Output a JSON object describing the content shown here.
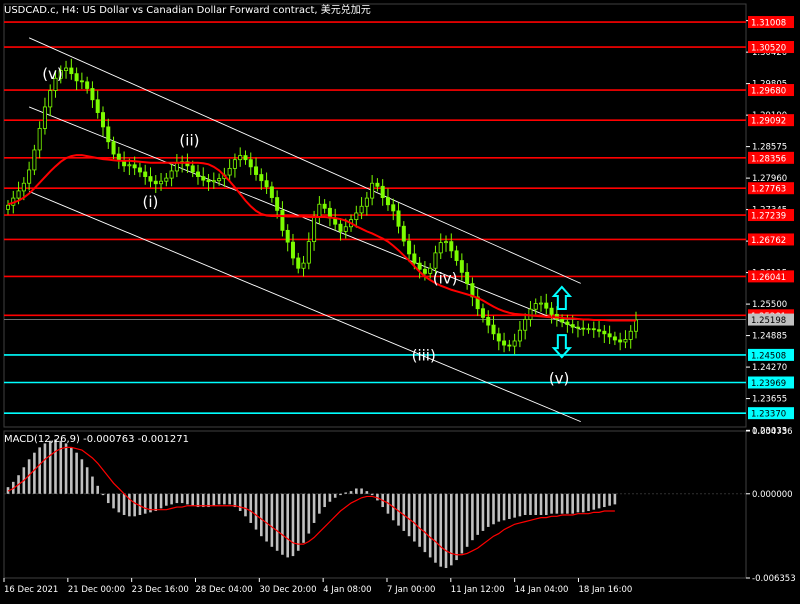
{
  "symbol_header": "USDCAD.c, H4: US Dollar vs Canadian Dollar Forward contract, 美元兑加元",
  "macd_header": "MACD(12,26,9) -0.000763 -0.001271",
  "colors": {
    "background": "#000000",
    "grid": "#1e2a30",
    "axis_text": "#ffffff",
    "bull_candle": "#7cfc00",
    "bear_candle": "#7cfc00",
    "ma_line": "#ff0000",
    "red_level": "#ff0000",
    "cyan_level": "#00ffff",
    "channel": "#ffffff",
    "macd_hist": "#c0c0c0",
    "macd_signal": "#ff0000",
    "price_tag_text": "#ffffff",
    "current_price_tag": "#c0c0c0"
  },
  "chart_data": [
    {
      "type": "candlestick",
      "title": "USDCAD.c, H4: US Dollar vs Canadian Dollar Forward contract, 美元兑加元",
      "ylim": [
        1.231,
        1.3136
      ],
      "y_ticks": [
        "1.31035",
        "1.30420",
        "1.29805",
        "1.29190",
        "1.28575",
        "1.27960",
        "1.27345",
        "1.26730",
        "1.26115",
        "1.25500",
        "1.24885",
        "1.24270",
        "1.23655",
        "1.23035"
      ],
      "x_ticks": [
        "16 Dec 2021",
        "21 Dec 00:00",
        "23 Dec 16:00",
        "28 Dec 04:00",
        "30 Dec 20:00",
        "4 Jan 08:00",
        "7 Jan 00:00",
        "11 Jan 12:00",
        "14 Jan 04:00",
        "18 Jan 16:00"
      ],
      "close_series": [
        1.2743,
        1.2757,
        1.2771,
        1.2786,
        1.2812,
        1.2851,
        1.2893,
        1.2935,
        1.2967,
        1.2991,
        1.3006,
        1.3011,
        1.3,
        1.2986,
        1.2984,
        1.2971,
        1.2949,
        1.2924,
        1.2896,
        1.2867,
        1.2843,
        1.283,
        1.282,
        1.2822,
        1.2816,
        1.2808,
        1.2799,
        1.279,
        1.2785,
        1.279,
        1.2796,
        1.281,
        1.2825,
        1.2828,
        1.282,
        1.2808,
        1.2799,
        1.2792,
        1.2789,
        1.2791,
        1.2795,
        1.2802,
        1.2815,
        1.2832,
        1.284,
        1.2832,
        1.2818,
        1.2803,
        1.2791,
        1.2779,
        1.2758,
        1.2733,
        1.2694,
        1.2671,
        1.264,
        1.262,
        1.263,
        1.2672,
        1.272,
        1.2745,
        1.2737,
        1.2718,
        1.2706,
        1.2692,
        1.2701,
        1.2715,
        1.2728,
        1.2741,
        1.2757,
        1.2786,
        1.278,
        1.2758,
        1.2744,
        1.2732,
        1.2702,
        1.2673,
        1.2648,
        1.263,
        1.2618,
        1.261,
        1.262,
        1.265,
        1.267,
        1.2672,
        1.2654,
        1.2635,
        1.2612,
        1.259,
        1.2564,
        1.2541,
        1.2524,
        1.2509,
        1.2492,
        1.2478,
        1.247,
        1.2468,
        1.2478,
        1.2499,
        1.252,
        1.254,
        1.2551,
        1.2552,
        1.2542,
        1.253,
        1.252,
        1.2515,
        1.251,
        1.2505,
        1.2503,
        1.2502,
        1.2502,
        1.25,
        1.2497,
        1.2492,
        1.2486,
        1.248,
        1.2476,
        1.2481,
        1.2497,
        1.2519
      ],
      "series": [
        {
          "name": "MA",
          "values": [
            1.2745,
            1.2748,
            1.2752,
            1.2758,
            1.2766,
            1.2776,
            1.2787,
            1.2798,
            1.2809,
            1.2819,
            1.2828,
            1.2835,
            1.2839,
            1.2841,
            1.2841,
            1.2839,
            1.2837,
            1.2835,
            1.2833,
            1.2832,
            1.2831,
            1.283,
            1.283,
            1.283,
            1.2829,
            1.2828,
            1.2827,
            1.2826,
            1.2826,
            1.2826,
            1.2826,
            1.2826,
            1.2826,
            1.2826,
            1.2826,
            1.2826,
            1.2826,
            1.2825,
            1.2823,
            1.2818,
            1.2811,
            1.2801,
            1.279,
            1.2778,
            1.2765,
            1.2752,
            1.2741,
            1.2732,
            1.2726,
            1.2723,
            1.2722,
            1.2722,
            1.2722,
            1.2721,
            1.2721,
            1.2721,
            1.2721,
            1.272,
            1.272,
            1.272,
            1.272,
            1.2719,
            1.2718,
            1.2716,
            1.2713,
            1.2708,
            1.2702,
            1.2697,
            1.2692,
            1.2688,
            1.2683,
            1.2678,
            1.2672,
            1.2664,
            1.2655,
            1.2645,
            1.2635,
            1.2624,
            1.2613,
            1.2604,
            1.2597,
            1.2591,
            1.2586,
            1.2582,
            1.2578,
            1.2575,
            1.2572,
            1.2569,
            1.2566,
            1.2562,
            1.2557,
            1.2551,
            1.2545,
            1.254,
            1.2536,
            1.2533,
            1.2531,
            1.253,
            1.2529,
            1.2528,
            1.2527,
            1.2526,
            1.2525,
            1.2524,
            1.2524,
            1.2523,
            1.2522,
            1.2522,
            1.2521,
            1.252,
            1.252,
            1.2519,
            1.2519,
            1.2519,
            1.2518,
            1.2518,
            1.2518,
            1.2518,
            1.2518,
            1.2518
          ]
        }
      ],
      "horizontal_levels": [
        {
          "label": "1.31008",
          "value": 1.31008,
          "color": "red"
        },
        {
          "label": "1.30520",
          "value": 1.3052,
          "color": "red"
        },
        {
          "label": "1.29680",
          "value": 1.2968,
          "color": "red"
        },
        {
          "label": "1.29092",
          "value": 1.29092,
          "color": "red"
        },
        {
          "label": "1.28356",
          "value": 1.28356,
          "color": "red"
        },
        {
          "label": "1.27763",
          "value": 1.27763,
          "color": "red"
        },
        {
          "label": "1.27239",
          "value": 1.27239,
          "color": "red"
        },
        {
          "label": "1.26762",
          "value": 1.26762,
          "color": "red"
        },
        {
          "label": "1.26041",
          "value": 1.26041,
          "color": "red"
        },
        {
          "label": "1.25281",
          "value": 1.25281,
          "color": "red"
        },
        {
          "label": "1.24508",
          "value": 1.24508,
          "color": "cyan"
        },
        {
          "label": "1.23969",
          "value": 1.23969,
          "color": "cyan"
        },
        {
          "label": "1.23370",
          "value": 1.2337,
          "color": "cyan"
        }
      ],
      "current_price": {
        "label": "1.25198",
        "value": 1.25198
      },
      "annotations": [
        {
          "text": "(v)",
          "x_index": 8,
          "y": 1.299
        },
        {
          "text": "(i)",
          "x_index": 27,
          "y": 1.274
        },
        {
          "text": "(ii)",
          "x_index": 34,
          "y": 1.286
        },
        {
          "text": "(iii)",
          "x_index": 78,
          "y": 1.244
        },
        {
          "text": "(iv)",
          "x_index": 82,
          "y": 1.259
        },
        {
          "text": "(v)",
          "x_index": 104,
          "y": 1.2395
        }
      ],
      "arrows": [
        {
          "direction": "up",
          "x_index": 104,
          "y": 1.256
        },
        {
          "direction": "down",
          "x_index": 104,
          "y": 1.247
        }
      ],
      "channel_lines": [
        {
          "from": [
            4,
            1.307
          ],
          "to": [
            100,
            1.261
          ]
        },
        {
          "from": [
            4,
            1.2935
          ],
          "to": [
            100,
            1.252
          ]
        },
        {
          "from": [
            4,
            1.277
          ],
          "to": [
            100,
            1.234
          ]
        }
      ],
      "grid": true,
      "scale": "linear"
    },
    {
      "type": "bar",
      "title": "MACD(12,26,9) -0.000763 -0.001271",
      "ylim": [
        -0.006353,
        0.004736
      ],
      "y_ticks": [
        "0.004736",
        "0.000000",
        "-0.006353"
      ],
      "series": [
        {
          "name": "MACD",
          "values": [
            0.0005,
            0.0009,
            0.0014,
            0.002,
            0.0026,
            0.0031,
            0.0035,
            0.0038,
            0.004,
            0.0041,
            0.004,
            0.0038,
            0.0035,
            0.0031,
            0.0026,
            0.002,
            0.0013,
            0.0006,
            -0.0001,
            -0.0007,
            -0.0011,
            -0.0014,
            -0.0016,
            -0.0017,
            -0.0017,
            -0.0016,
            -0.0015,
            -0.0014,
            -0.0013,
            -0.0011,
            -0.0009,
            -0.0008,
            -0.0007,
            -0.0007,
            -0.0008,
            -0.0009,
            -0.001,
            -0.001,
            -0.001,
            -0.0009,
            -0.0008,
            -0.0008,
            -0.0008,
            -0.001,
            -0.0013,
            -0.0017,
            -0.0022,
            -0.0027,
            -0.0032,
            -0.0036,
            -0.004,
            -0.0043,
            -0.0046,
            -0.0048,
            -0.0047,
            -0.0043,
            -0.0037,
            -0.003,
            -0.0022,
            -0.0015,
            -0.001,
            -0.0006,
            -0.0003,
            -0.0001,
            0.0001,
            0.0002,
            0.0004,
            0.0004,
            0.0002,
            -0.0001,
            -0.0005,
            -0.001,
            -0.0015,
            -0.002,
            -0.0024,
            -0.0028,
            -0.0032,
            -0.0036,
            -0.004,
            -0.0044,
            -0.0048,
            -0.0052,
            -0.0055,
            -0.0056,
            -0.0054,
            -0.005,
            -0.0045,
            -0.004,
            -0.0035,
            -0.0031,
            -0.0028,
            -0.0025,
            -0.0023,
            -0.0021,
            -0.002,
            -0.0019,
            -0.0018,
            -0.0017,
            -0.0016,
            -0.0016,
            -0.0016,
            -0.0016,
            -0.0016,
            -0.0015,
            -0.0015,
            -0.0015,
            -0.0015,
            -0.0015,
            -0.0014,
            -0.0014,
            -0.0013,
            -0.0012,
            -0.0011,
            -0.001,
            -0.0009,
            -0.0008
          ]
        },
        {
          "name": "Signal",
          "values": [
            0.0002,
            0.0004,
            0.0007,
            0.001,
            0.0014,
            0.0018,
            0.0022,
            0.0026,
            0.0029,
            0.0032,
            0.0034,
            0.0035,
            0.0035,
            0.0034,
            0.0033,
            0.003,
            0.0027,
            0.0023,
            0.0018,
            0.0013,
            0.0008,
            0.0004,
            0.0,
            -0.0004,
            -0.0007,
            -0.0009,
            -0.0011,
            -0.0012,
            -0.0012,
            -0.0012,
            -0.0012,
            -0.0011,
            -0.001,
            -0.001,
            -0.0009,
            -0.0009,
            -0.0009,
            -0.0009,
            -0.0009,
            -0.0009,
            -0.0009,
            -0.0009,
            -0.0009,
            -0.0009,
            -0.001,
            -0.0011,
            -0.0013,
            -0.0016,
            -0.0019,
            -0.0022,
            -0.0025,
            -0.0028,
            -0.0031,
            -0.0034,
            -0.0037,
            -0.0038,
            -0.0038,
            -0.0036,
            -0.0033,
            -0.0029,
            -0.0025,
            -0.0021,
            -0.0017,
            -0.0013,
            -0.001,
            -0.0007,
            -0.0005,
            -0.0003,
            -0.0002,
            -0.0002,
            -0.0003,
            -0.0005,
            -0.0007,
            -0.001,
            -0.0013,
            -0.0016,
            -0.0019,
            -0.0022,
            -0.0026,
            -0.0029,
            -0.0033,
            -0.0036,
            -0.004,
            -0.0043,
            -0.0045,
            -0.0046,
            -0.0046,
            -0.0045,
            -0.0043,
            -0.0041,
            -0.0038,
            -0.0035,
            -0.0032,
            -0.003,
            -0.0027,
            -0.0025,
            -0.0023,
            -0.0022,
            -0.0021,
            -0.002,
            -0.0019,
            -0.0018,
            -0.0018,
            -0.0017,
            -0.0017,
            -0.0016,
            -0.0016,
            -0.0016,
            -0.0015,
            -0.0015,
            -0.0015,
            -0.0014,
            -0.0014,
            -0.0013,
            -0.0013,
            -0.0013
          ]
        }
      ]
    }
  ]
}
